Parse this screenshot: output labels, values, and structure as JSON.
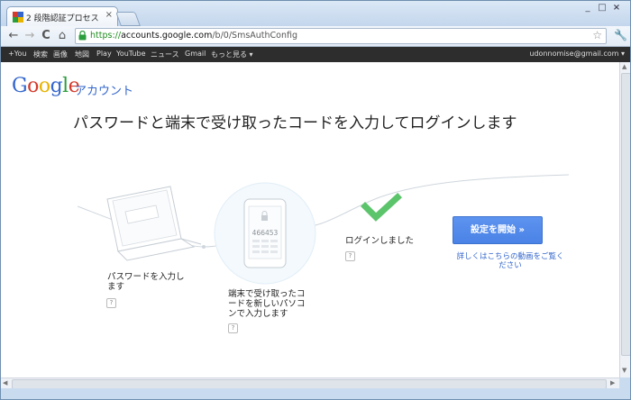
{
  "tab": {
    "title": "2 段階認証プロセス",
    "close": "×"
  },
  "toolbar": {
    "back": "←",
    "forward": "→",
    "reload": "C",
    "home": "⌂",
    "url_scheme": "https://",
    "url_host": "accounts.google.com",
    "url_path": "/b/0/SmsAuthConfig",
    "star": "☆",
    "wrench": "🔧"
  },
  "gbar": {
    "items": [
      "+You",
      "検索",
      "画像",
      "地図",
      "Play",
      "YouTube",
      "ニュース",
      "Gmail",
      "もっと見る ▾"
    ],
    "user": "udonnomise@gmail.com ▾"
  },
  "page": {
    "logo": {
      "G": "G",
      "o1": "o",
      "o2": "o",
      "g": "g",
      "l": "l",
      "e": "e"
    },
    "account": "アカウント",
    "headline": "パスワードと端末で受け取ったコードを入力してログインします",
    "phone_code": "466453",
    "step1": "パスワードを入力します",
    "step2": "端末で受け取ったコードを新しいパソコンで入力します",
    "step3": "ログインしました",
    "help": "?",
    "start_button": "設定を開始 »",
    "more_link": "詳しくはこちらの動画をご覧ください"
  },
  "colors": {
    "accent": "#4a83e6",
    "link": "#3366cc",
    "check": "#5cc46b"
  }
}
